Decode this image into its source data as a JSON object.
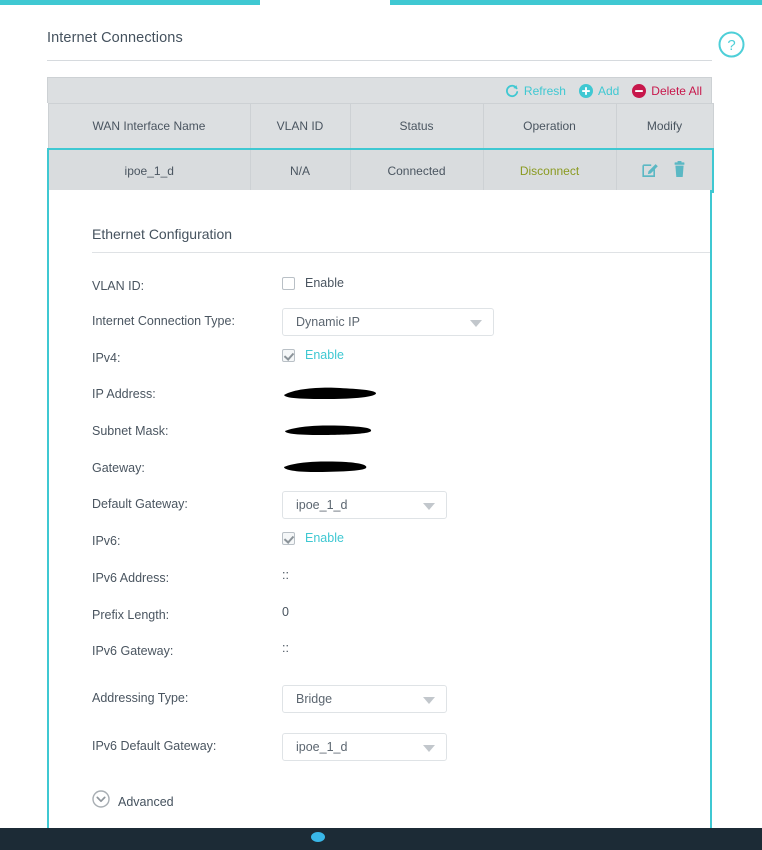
{
  "nav": {
    "segments": 2
  },
  "header": {
    "title": "Internet Connections",
    "help_icon": "help-circle-icon"
  },
  "toolbar": {
    "refresh_label": "Refresh",
    "refresh_icon": "refresh-icon",
    "add_label": "Add",
    "add_icon": "plus-circle-icon",
    "delete_all_label": "Delete All",
    "delete_all_icon": "minus-circle-icon"
  },
  "table": {
    "columns": [
      "WAN Interface Name",
      "VLAN ID",
      "Status",
      "Operation",
      "Modify"
    ],
    "rows": [
      {
        "wan_interface_name": "ipoe_1_d",
        "vlan_id": "N/A",
        "status": "Connected",
        "operation": "Disconnect",
        "edit_icon": "edit-pencil-icon",
        "delete_icon": "trash-icon",
        "selected": true
      }
    ]
  },
  "detail": {
    "section_title": "Ethernet Configuration",
    "fields": {
      "vlan_id": {
        "label": "VLAN ID:",
        "checkbox_label": "Enable",
        "checked": false
      },
      "connection_type": {
        "label": "Internet Connection Type:",
        "value": "Dynamic IP"
      },
      "ipv4": {
        "label": "IPv4:",
        "checkbox_label": "Enable",
        "checked": true
      },
      "ip_address": {
        "label": "IP Address:",
        "value": "",
        "redacted": true
      },
      "subnet_mask": {
        "label": "Subnet Mask:",
        "value": "",
        "redacted": true
      },
      "gateway": {
        "label": "Gateway:",
        "value": "",
        "redacted": true
      },
      "default_gateway": {
        "label": "Default Gateway:",
        "value": "ipoe_1_d"
      },
      "ipv6": {
        "label": "IPv6:",
        "checkbox_label": "Enable",
        "checked": true
      },
      "ipv6_address": {
        "label": "IPv6 Address:",
        "value": "::"
      },
      "prefix_length": {
        "label": "Prefix Length:",
        "value": "0"
      },
      "ipv6_gateway": {
        "label": "IPv6 Gateway:",
        "value": "::"
      },
      "addressing_type": {
        "label": "Addressing Type:",
        "value": "Bridge"
      },
      "ipv6_default_gateway": {
        "label": "IPv6 Default Gateway:",
        "value": "ipoe_1_d"
      }
    },
    "advanced": {
      "label": "Advanced",
      "icon": "chevron-down-circle-icon"
    }
  },
  "colors": {
    "accent_teal": "#3fc8d2",
    "delete_red": "#c7174b",
    "operation_green": "#8a9a20",
    "footer_navy": "#1c2b36",
    "table_header_gray": "#dcdfe1"
  }
}
